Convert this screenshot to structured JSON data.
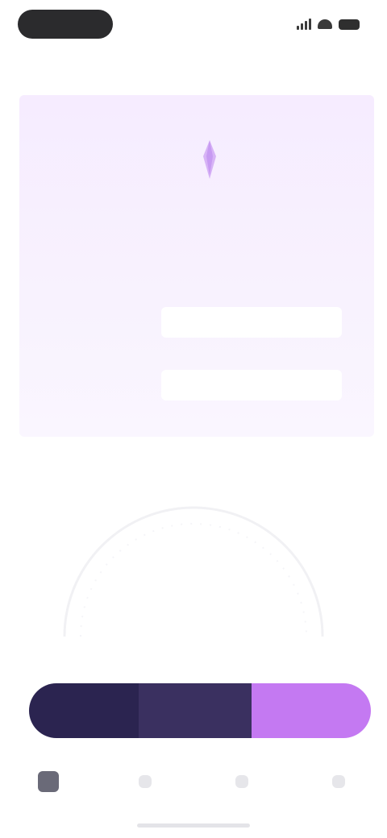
{
  "status_bar": {
    "icons": [
      "signal-icon",
      "wifi-icon",
      "battery-icon"
    ]
  },
  "header": {
    "title": ""
  },
  "card": {
    "icon": "location-pin-icon",
    "title": "",
    "subtitle": "",
    "fields": [
      {
        "label": "",
        "value": ""
      },
      {
        "label": "",
        "value": ""
      }
    ]
  },
  "gauge": {
    "label": "",
    "value": "",
    "caption": ""
  },
  "segments": [
    {
      "label": "",
      "color": "#2b2450"
    },
    {
      "label": "",
      "color": "#3a3060"
    },
    {
      "label": "",
      "color": "#c479f2"
    }
  ],
  "tabs": [
    {
      "icon": "home-icon",
      "active": true
    },
    {
      "icon": "tab-icon",
      "active": false
    },
    {
      "icon": "tab-icon",
      "active": false
    },
    {
      "icon": "tab-icon",
      "active": false
    }
  ],
  "colors": {
    "accent": "#c479f2",
    "card_background": "#f6ecff",
    "dark": "#2b2450"
  }
}
